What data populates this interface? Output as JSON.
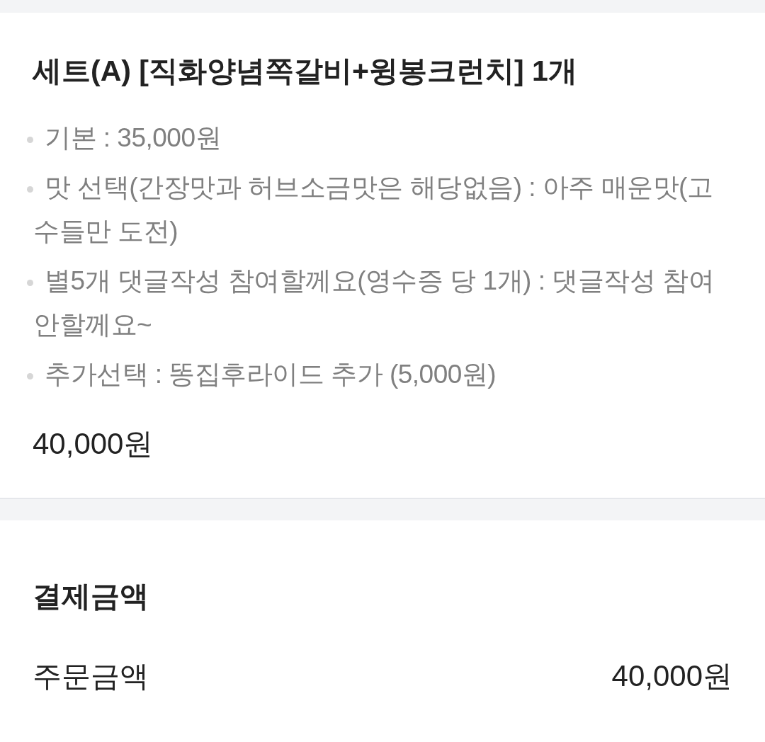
{
  "order_item": {
    "title": "세트(A) [직화양념쪽갈비+윙봉크런치] 1개",
    "options": [
      "기본 : 35,000원",
      "맛 선택(간장맛과 허브소금맛은 해당없음) : 아주 매운맛(고수들만 도전)",
      "별5개 댓글작성 참여할께요(영수증 당 1개) : 댓글작성 참여 안할께요~",
      "추가선택 : 똥집후라이드 추가 (5,000원)"
    ],
    "price": "40,000원"
  },
  "payment": {
    "heading": "결제금액",
    "rows": [
      {
        "label": "주문금액",
        "value": "40,000원"
      }
    ]
  }
}
